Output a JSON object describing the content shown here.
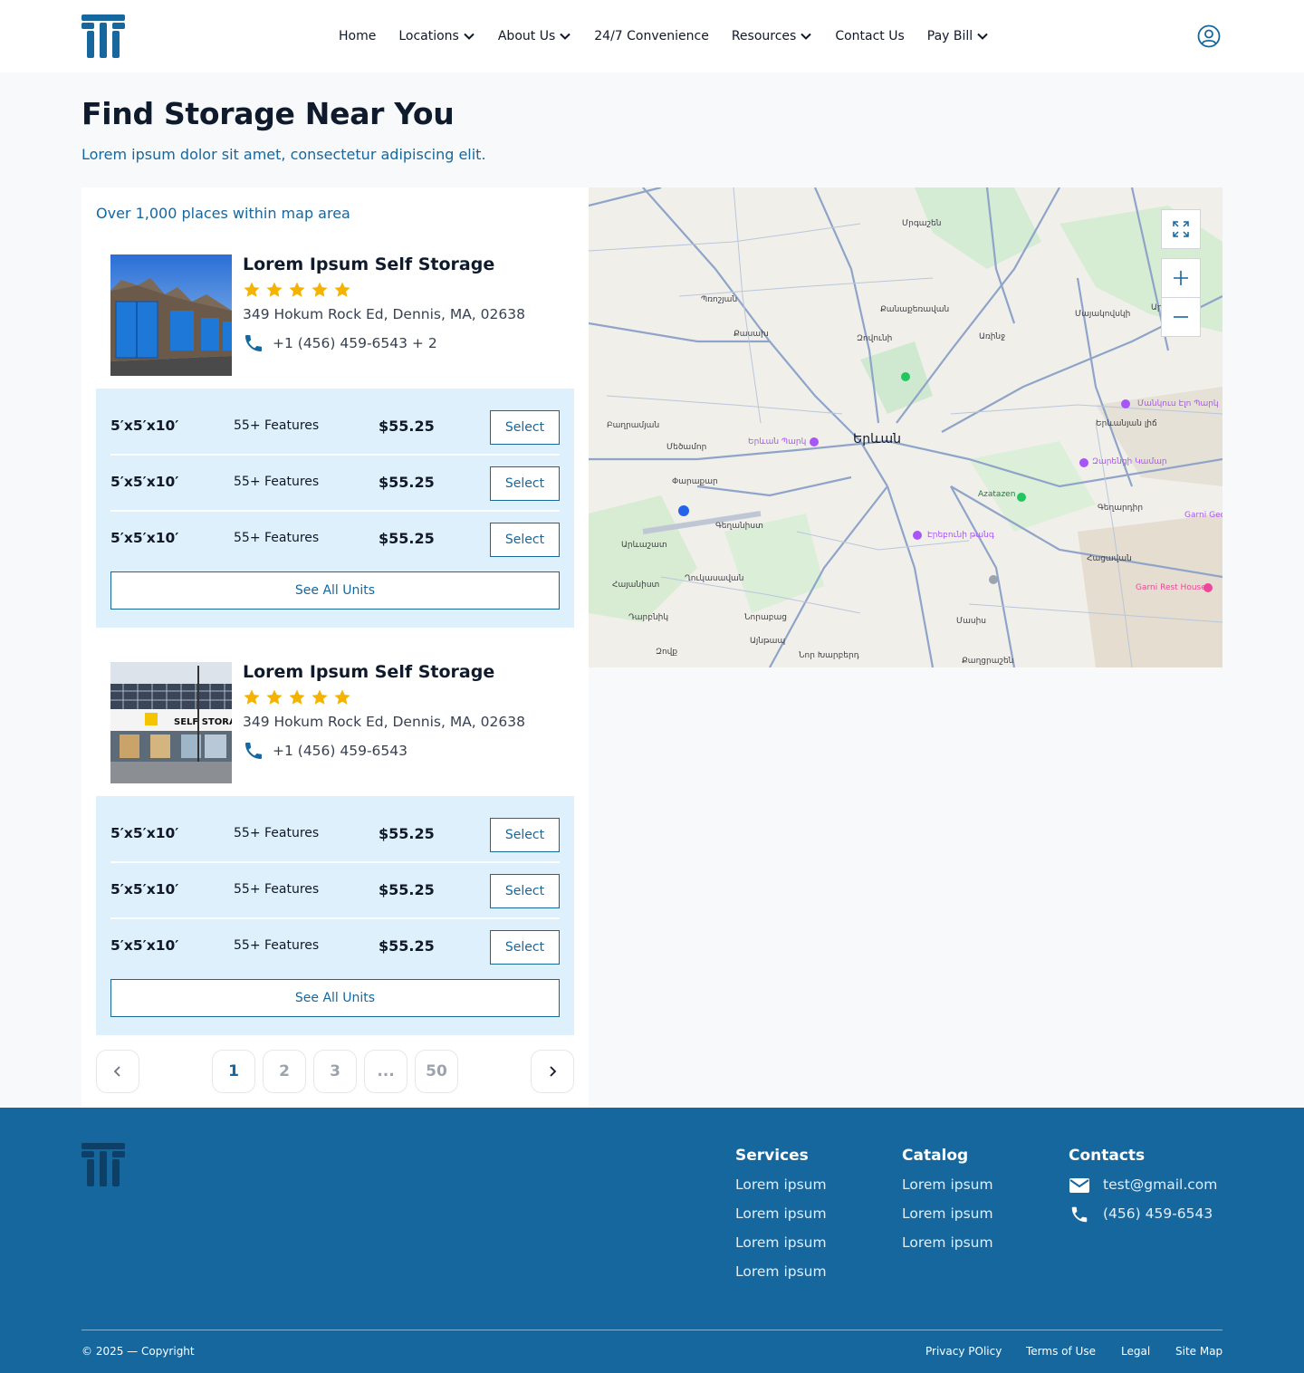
{
  "header": {
    "nav": [
      {
        "label": "Home",
        "has_dropdown": false
      },
      {
        "label": "Locations",
        "has_dropdown": true
      },
      {
        "label": "About Us",
        "has_dropdown": true
      },
      {
        "label": "24/7 Convenience",
        "has_dropdown": false
      },
      {
        "label": "Resources",
        "has_dropdown": true
      },
      {
        "label": "Contact Us",
        "has_dropdown": false
      },
      {
        "label": "Pay Bill",
        "has_dropdown": true
      }
    ],
    "user_icon": "user-circle-icon"
  },
  "page": {
    "title": "Find Storage Near You",
    "subtitle": "Lorem ipsum dolor sit amet, consectetur adipiscing elit."
  },
  "results": {
    "count_text": "Over 1,000 places within map area",
    "listings": [
      {
        "name": "Lorem Ipsum Self Storage",
        "rating": 5,
        "address": "349 Hokum Rock Ed, Dennis, MA, 02638",
        "phone": "+1 (456) 459-6543 + 2",
        "units": [
          {
            "size": "5′x5′x10′",
            "features": "55+ Features",
            "price": "$55.25",
            "action": "Select"
          },
          {
            "size": "5′x5′x10′",
            "features": "55+ Features",
            "price": "$55.25",
            "action": "Select"
          },
          {
            "size": "5′x5′x10′",
            "features": "55+ Features",
            "price": "$55.25",
            "action": "Select"
          }
        ],
        "see_all": "See All Units"
      },
      {
        "name": "Lorem Ipsum Self Storage",
        "rating": 5,
        "address": "349 Hokum Rock Ed, Dennis, MA, 02638",
        "phone": "+1 (456) 459-6543",
        "image_text": "SELF STORAG",
        "units": [
          {
            "size": "5′x5′x10′",
            "features": "55+ Features",
            "price": "$55.25",
            "action": "Select"
          },
          {
            "size": "5′x5′x10′",
            "features": "55+ Features",
            "price": "$55.25",
            "action": "Select"
          },
          {
            "size": "5′x5′x10′",
            "features": "55+ Features",
            "price": "$55.25",
            "action": "Select"
          }
        ],
        "see_all": "See All Units"
      }
    ]
  },
  "pagination": {
    "pages": [
      "1",
      "2",
      "3",
      "...",
      "50"
    ],
    "current": "1"
  },
  "map": {
    "city": "Երևան",
    "labels": [
      "Մրգաշեն",
      "Քանաքեռավան",
      "Պռոշյան",
      "Քասախ",
      "Զովունի",
      "Առինջ",
      "Մայակովսկի",
      "Արամուս",
      "Բաղրամյան",
      "Մեծամոր",
      "Փարաքար",
      "Գեղանիստ",
      "Արևաշատ",
      "Հայանիստ",
      "Ղուկասավան",
      "Դարբնիկ",
      "Նորաբաց",
      "Այնթապ",
      "Նոր Խարբերդ",
      "Քաղցրաշեն",
      "Գեղարդիր",
      "Հացավան",
      "Զովք",
      "Մասիս",
      "Երևանյան լիճ"
    ],
    "pois": [
      "Երևան Պարկ",
      "Մանկուս Էլո Պարկ",
      "Զարենցի Կամար",
      "Azatazen",
      "Էրեբունի թանգ",
      "Garni Rest House",
      "Garni Geop Obs"
    ],
    "accent_colors": {
      "park": "#a855f7",
      "green": "#22c55e",
      "pink": "#ec4899"
    }
  },
  "footer": {
    "services": {
      "heading": "Services",
      "links": [
        "Lorem ipsum",
        "Lorem ipsum",
        "Lorem ipsum",
        "Lorem ipsum"
      ]
    },
    "catalog": {
      "heading": "Catalog",
      "links": [
        "Lorem ipsum",
        "Lorem ipsum",
        "Lorem ipsum"
      ]
    },
    "contacts": {
      "heading": "Contacts",
      "email": "test@gmail.com",
      "phone": "(456) 459-6543"
    },
    "copyright": "© 2025 — Copyright",
    "legal_links": [
      "Privacy POlicy",
      "Terms of Use",
      "Legal",
      "Site Map"
    ]
  },
  "colors": {
    "primary": "#16679e",
    "units_bg": "#dff0fd",
    "star": "#f5b301",
    "title": "#0f1b2d"
  }
}
